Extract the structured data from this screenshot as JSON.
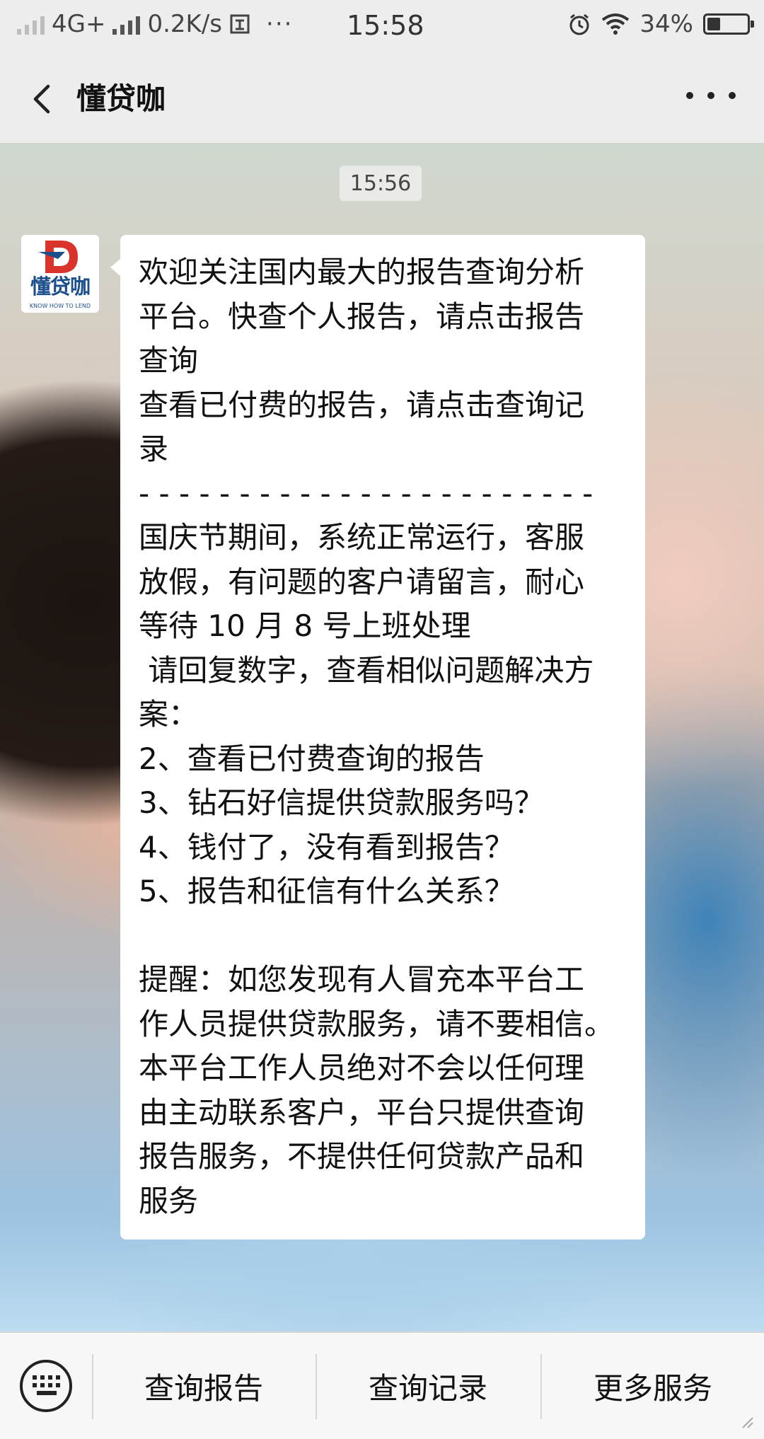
{
  "status_bar": {
    "network": "4G+",
    "speed": "0.2K/s",
    "time": "15:58",
    "battery_level_text": "34%",
    "battery_fraction": 0.34
  },
  "nav": {
    "title": "懂贷咖"
  },
  "chat": {
    "timestamp": "15:56",
    "avatar_brand": "懂贷咖",
    "avatar_tagline": "KNOW HOW TO LEND",
    "message_lines": [
      "欢迎关注国内最大的报告查询分析",
      "平台。快查个人报告，请点击报告",
      "查询",
      "查看已付费的报告，请点击查询记",
      "录",
      "- - - - - - - - - - - - - - - - - - - - - - -",
      "国庆节期间，系统正常运行，客服",
      "放假，有问题的客户请留言，耐心",
      "等待 10 月 8 号上班处理",
      " 请回复数字，查看相似问题解决方",
      "案：",
      "2、查看已付费查询的报告",
      "3、钻石好信提供贷款服务吗？",
      "4、钱付了，没有看到报告？",
      "5、报告和征信有什么关系？",
      "",
      "提醒：如您发现有人冒充本平台工",
      "作人员提供贷款服务，请不要相信。",
      "本平台工作人员绝对不会以任何理",
      "由主动联系客户，平台只提供查询",
      "报告服务，不提供任何贷款产品和",
      "服务"
    ]
  },
  "bottom_menu": {
    "items": [
      "查询报告",
      "查询记录",
      "更多服务"
    ]
  },
  "colors": {
    "bar_background": "#ededed",
    "bubble": "#ffffff",
    "brand_red": "#d9332b",
    "brand_blue": "#1b4f8c"
  }
}
